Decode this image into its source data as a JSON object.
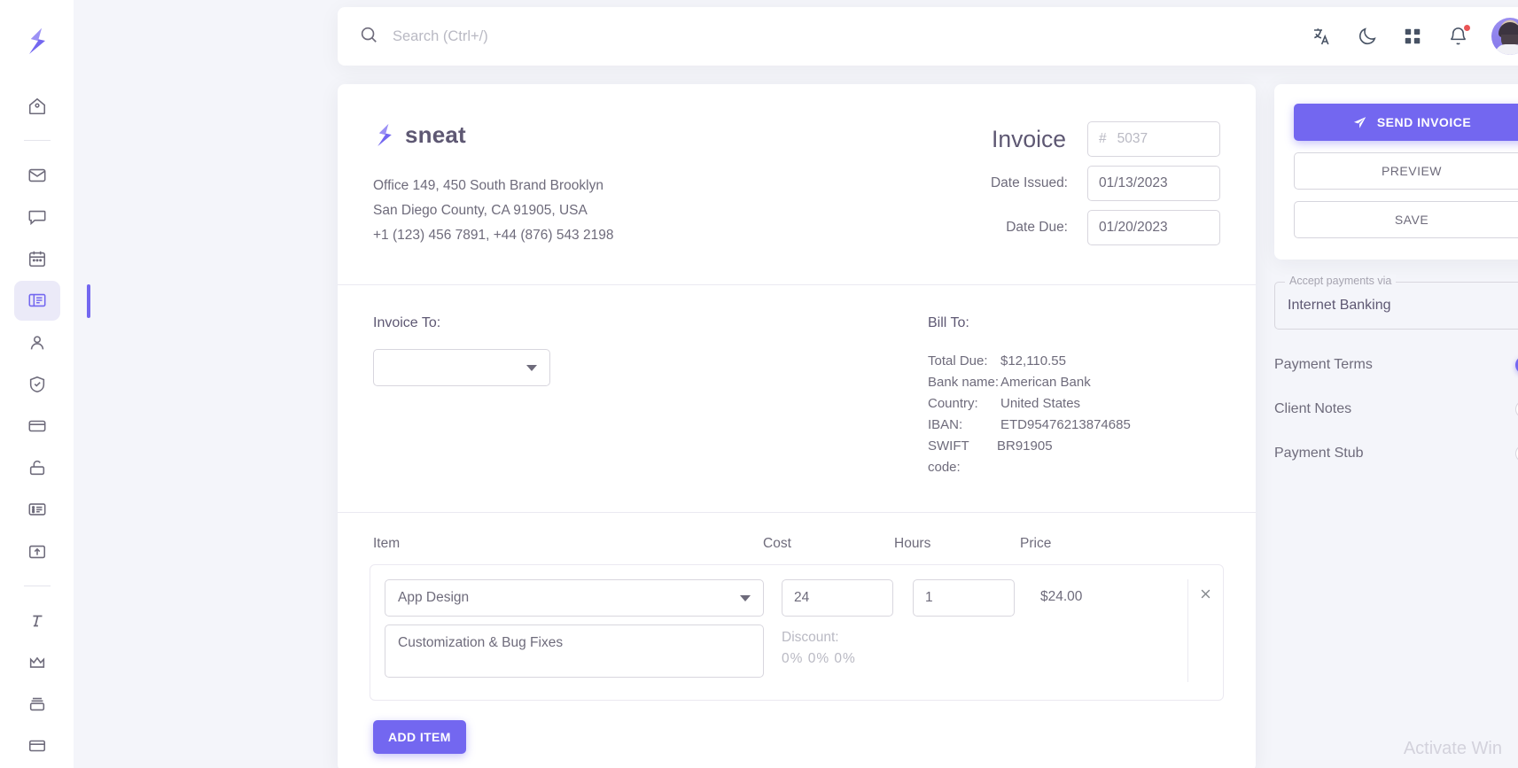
{
  "sidebar": {
    "logo": "sneat-logo",
    "items": [
      {
        "name": "home",
        "icon": "home-icon",
        "active": false
      },
      {
        "name": "email",
        "icon": "mail-icon",
        "active": false
      },
      {
        "name": "chat",
        "icon": "chat-icon",
        "active": false
      },
      {
        "name": "calendar",
        "icon": "calendar-icon",
        "active": false
      },
      {
        "name": "invoice",
        "icon": "invoice-icon",
        "active": true
      },
      {
        "name": "user",
        "icon": "user-icon",
        "active": false
      },
      {
        "name": "roles-permissions",
        "icon": "shield-icon",
        "active": false
      },
      {
        "name": "pricing",
        "icon": "credit-card-icon",
        "active": false
      },
      {
        "name": "authentication",
        "icon": "lock-icon",
        "active": false
      },
      {
        "name": "wizard",
        "icon": "list-icon",
        "active": false
      },
      {
        "name": "modal",
        "icon": "export-icon",
        "active": false
      },
      {
        "name": "typography",
        "icon": "typography-icon",
        "active": false
      },
      {
        "name": "icons",
        "icon": "crown-icon",
        "active": false
      },
      {
        "name": "cards",
        "icon": "layers-icon",
        "active": false
      },
      {
        "name": "tables",
        "icon": "table-icon",
        "active": false
      }
    ]
  },
  "topbar": {
    "search_placeholder": "Search (Ctrl+/)",
    "search_value": "",
    "icons": [
      {
        "name": "translate-icon"
      },
      {
        "name": "dark-mode-icon"
      },
      {
        "name": "apps-grid-icon"
      },
      {
        "name": "notification-bell-icon",
        "has_badge": true
      }
    ],
    "avatar": {
      "name": "user-avatar",
      "status": "online"
    }
  },
  "invoice": {
    "company": {
      "name": "sneat",
      "address_line1": "Office 149, 450 South Brand Brooklyn",
      "address_line2": "San Diego County, CA 91905, USA",
      "phone": "+1 (123) 456 7891, +44 (876) 543 2198"
    },
    "title": "Invoice",
    "number_prefix": "#",
    "number": "5037",
    "date_issued_label": "Date Issued:",
    "date_issued": "01/13/2023",
    "date_due_label": "Date Due:",
    "date_due": "01/20/2023",
    "invoice_to_label": "Invoice To:",
    "invoice_to_value": "",
    "bill_to_label": "Bill To:",
    "bill_to": [
      {
        "key": "Total Due:",
        "value": "$12,110.55"
      },
      {
        "key": "Bank name:",
        "value": "American Bank"
      },
      {
        "key": "Country:",
        "value": "United States"
      },
      {
        "key": "IBAN:",
        "value": "ETD95476213874685"
      },
      {
        "key": "SWIFT code:",
        "value": "BR91905"
      }
    ],
    "columns": {
      "item": "Item",
      "cost": "Cost",
      "hours": "Hours",
      "price": "Price"
    },
    "rows": [
      {
        "item": "App Design",
        "description": "Customization & Bug Fixes",
        "cost": "24",
        "hours": "1",
        "price": "$24.00",
        "discount_label": "Discount:",
        "discount_values": "0%  0%  0%"
      }
    ],
    "add_item_label": "ADD ITEM"
  },
  "actions": {
    "send_invoice": "SEND INVOICE",
    "send_icon": "send-plane-icon",
    "preview": "PREVIEW",
    "save": "SAVE"
  },
  "payment": {
    "legend": "Accept payments via",
    "selected": "Internet Banking",
    "toggles": [
      {
        "label": "Payment Terms",
        "on": true
      },
      {
        "label": "Client Notes",
        "on": false
      },
      {
        "label": "Payment Stub",
        "on": false
      }
    ]
  },
  "watermark": "Activate Win",
  "colors": {
    "primary": "#7367f0",
    "background": "#f4f5fa",
    "text": "#6e6b7b",
    "danger": "#ea5455",
    "success": "#28c76f"
  }
}
